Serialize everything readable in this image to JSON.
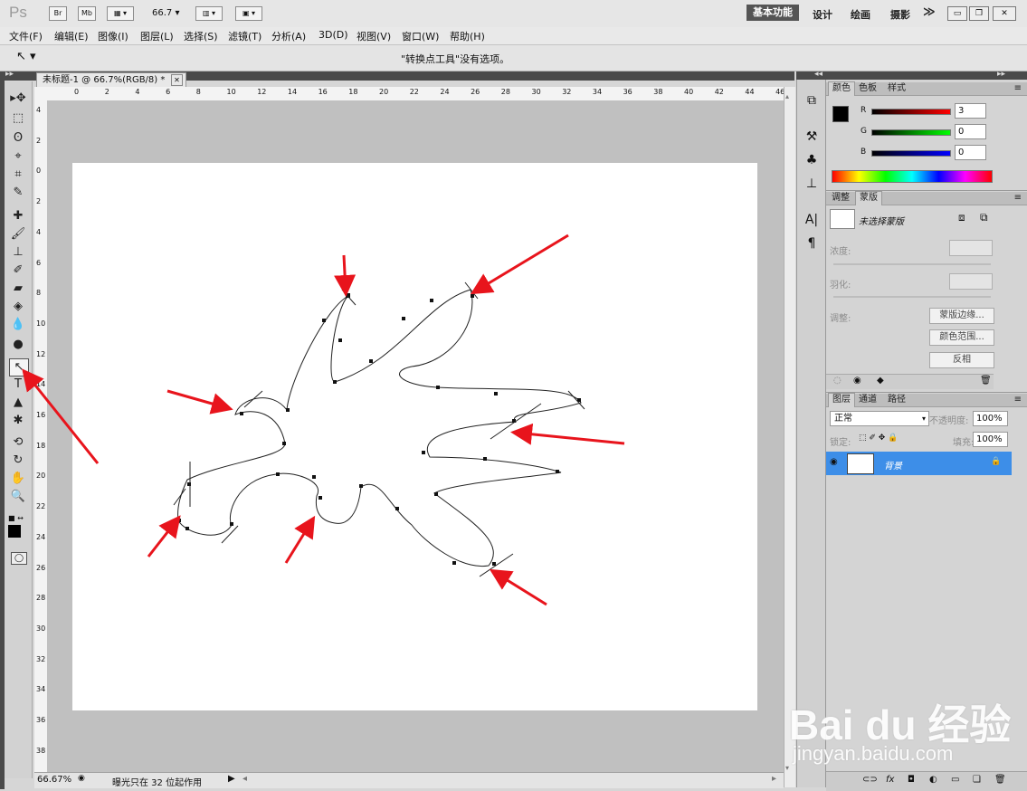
{
  "app": {
    "logo": "Ps",
    "bridge_btn": "Br",
    "minibridge_btn": "Mb",
    "zoom_value": "66.7",
    "workspaces": [
      "基本功能",
      "设计",
      "绘画",
      "摄影"
    ],
    "more": "≫"
  },
  "menu": [
    "文件(F)",
    "编辑(E)",
    "图像(I)",
    "图层(L)",
    "选择(S)",
    "滤镜(T)",
    "分析(A)",
    "3D(D)",
    "视图(V)",
    "窗口(W)",
    "帮助(H)"
  ],
  "options_bar": {
    "message": "\"转换点工具\"没有选项。"
  },
  "document": {
    "tab_title": "未标题-1 @ 66.7%(RGB/8) *",
    "top_ruler_ticks": [
      "0",
      "2",
      "4",
      "6",
      "8",
      "10",
      "12",
      "14",
      "16",
      "18",
      "20",
      "22",
      "24",
      "26",
      "28",
      "30",
      "32",
      "34",
      "36",
      "38",
      "40",
      "42",
      "44",
      "46"
    ],
    "left_ruler_ticks": [
      "4",
      "2",
      "0",
      "2",
      "4",
      "6",
      "8",
      "10",
      "12",
      "14",
      "16",
      "18",
      "20",
      "22",
      "24",
      "26",
      "28",
      "30",
      "32",
      "34",
      "36",
      "38"
    ],
    "status_zoom": "66.67%",
    "status_text": "曝光只在 32 位起作用"
  },
  "color_panel": {
    "tabs": [
      "颜色",
      "色板",
      "样式"
    ],
    "r_label": "R",
    "g_label": "G",
    "b_label": "B",
    "r": "3",
    "g": "0",
    "b": "0"
  },
  "masks_panel": {
    "tabs": [
      "调整",
      "蒙版"
    ],
    "no_mask": "未选择蒙版",
    "density_label": "浓度:",
    "feather_label": "羽化:",
    "refine_label": "调整:",
    "btn_mask_edge": "蒙版边缘...",
    "btn_color_range": "颜色范围...",
    "btn_invert": "反相"
  },
  "layers_panel": {
    "tabs": [
      "图层",
      "通道",
      "路径"
    ],
    "blend_mode": "正常",
    "opacity_label": "不透明度:",
    "opacity": "100%",
    "lock_label": "锁定:",
    "fill_label": "填充:",
    "fill": "100%",
    "layer_name": "背景"
  },
  "watermark": {
    "brand": "Bai du 经验",
    "url": "jingyan.baidu.com"
  },
  "colors": {
    "selection_blue": "#3d8ee8",
    "arrow_red": "#e8141c"
  }
}
